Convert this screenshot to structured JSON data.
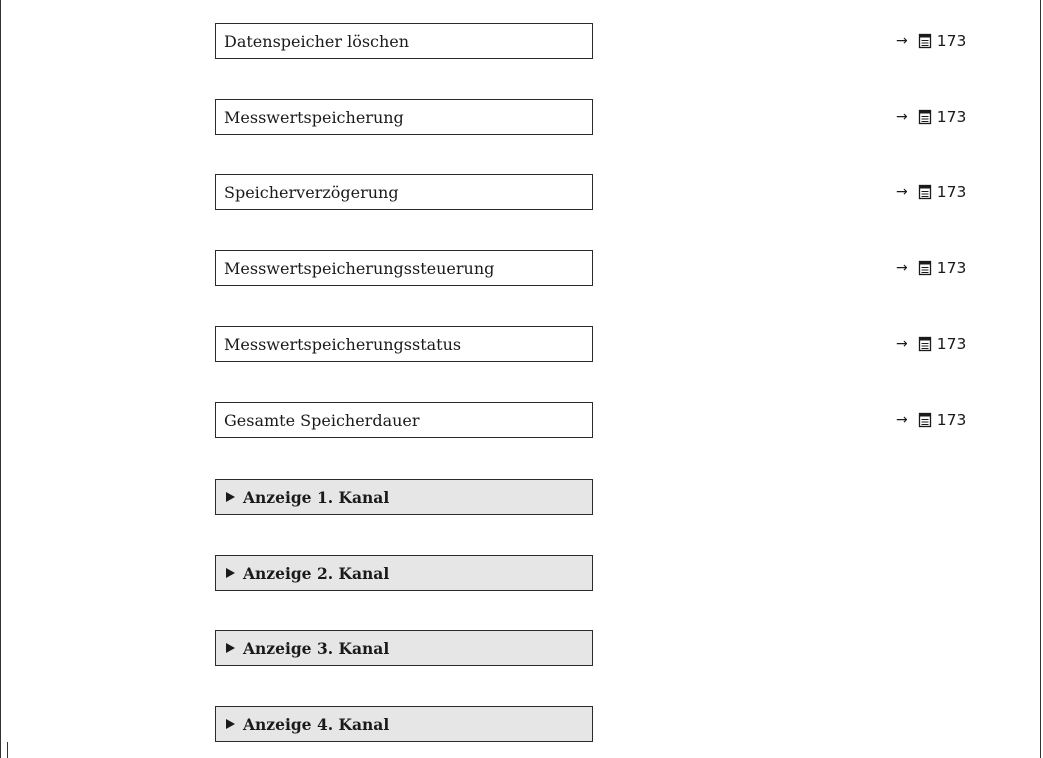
{
  "rows": [
    {
      "label": "Datenspeicher löschen",
      "ref_arrow": "→",
      "ref_page": "173"
    },
    {
      "label": "Messwertspeicherung",
      "ref_arrow": "→",
      "ref_page": "173"
    },
    {
      "label": "Speicherverzögerung",
      "ref_arrow": "→",
      "ref_page": "173"
    },
    {
      "label": "Messwertspeicherungssteuerung",
      "ref_arrow": "→",
      "ref_page": "173"
    },
    {
      "label": "Messwertspeicherungsstatus",
      "ref_arrow": "→",
      "ref_page": "173"
    },
    {
      "label": "Gesamte Speicherdauer",
      "ref_arrow": "→",
      "ref_page": "173"
    }
  ],
  "submenus": [
    {
      "label": "Anzeige 1. Kanal"
    },
    {
      "label": "Anzeige 2. Kanal"
    },
    {
      "label": "Anzeige 3. Kanal"
    },
    {
      "label": "Anzeige 4. Kanal"
    }
  ],
  "icons": {
    "reference": "page-reference-icon",
    "submenu": "submenu-triangle-icon"
  }
}
